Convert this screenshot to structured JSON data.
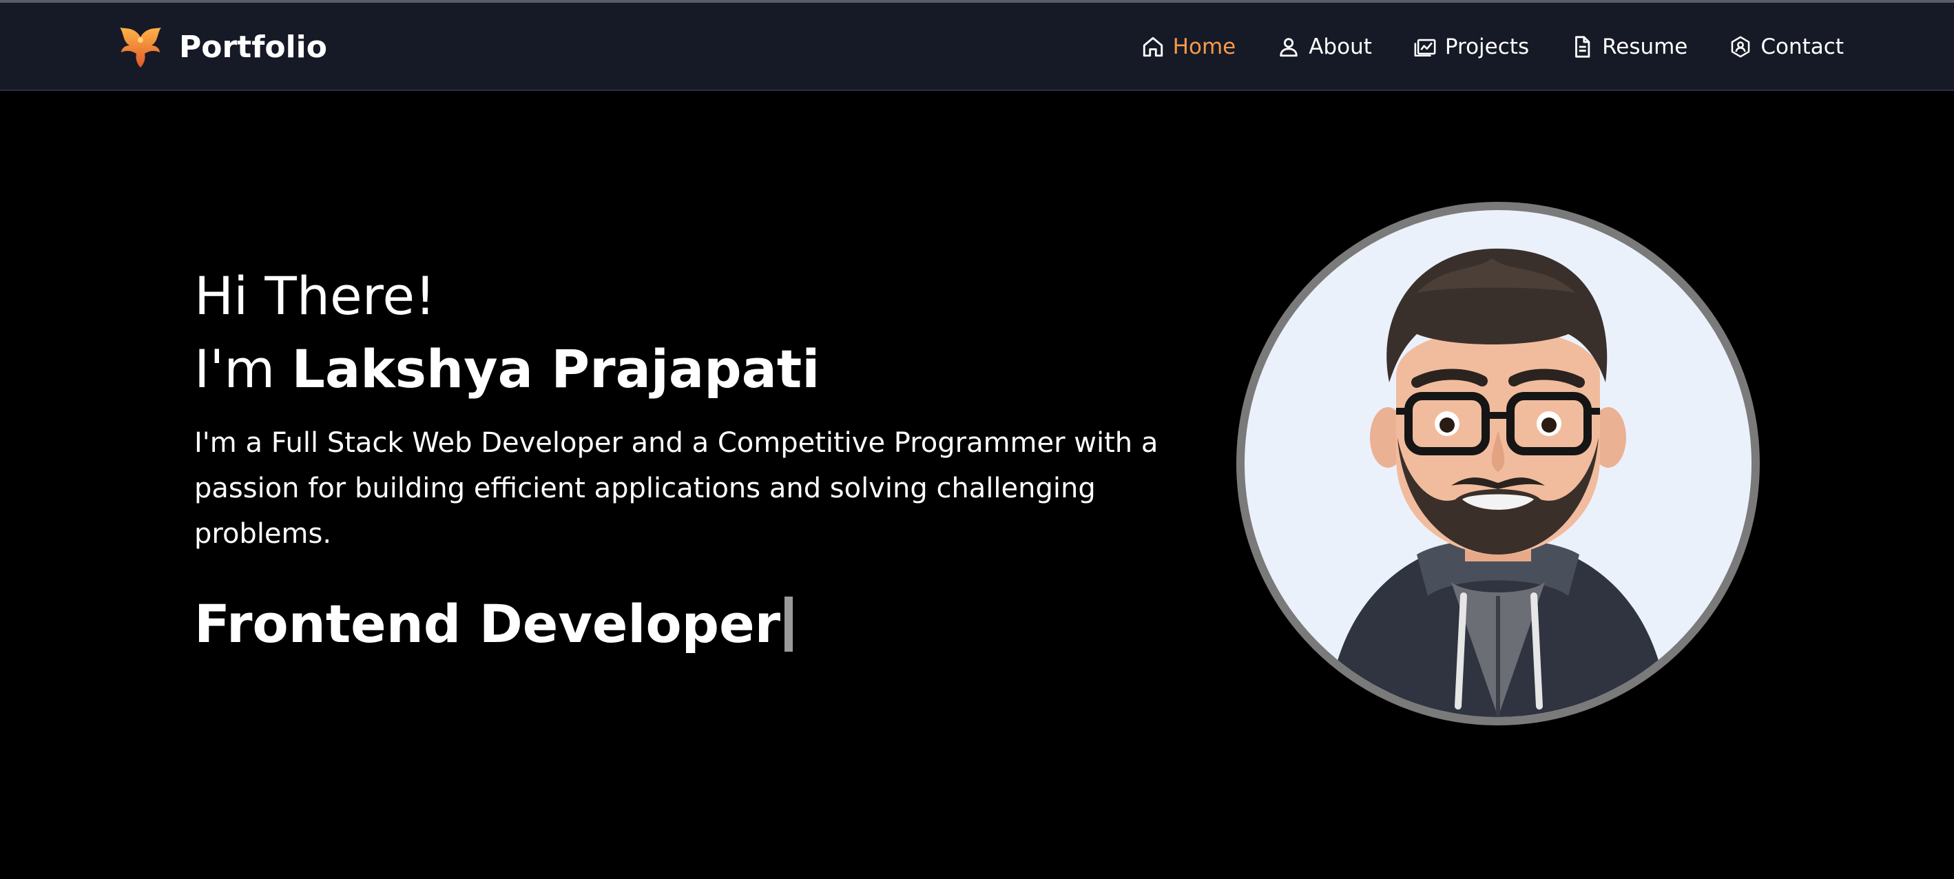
{
  "brand": {
    "title": "Portfolio",
    "logo_icon": "phoenix-logo-icon"
  },
  "nav": {
    "items": [
      {
        "label": "Home",
        "icon": "home-icon",
        "active": true
      },
      {
        "label": "About",
        "icon": "user-icon",
        "active": false
      },
      {
        "label": "Projects",
        "icon": "projects-icon",
        "active": false
      },
      {
        "label": "Resume",
        "icon": "document-icon",
        "active": false
      },
      {
        "label": "Contact",
        "icon": "contact-icon",
        "active": false
      }
    ]
  },
  "hero": {
    "greeting": "Hi There!",
    "intro_prefix": "I'm",
    "name": "Lakshya Prajapati",
    "bio": "I'm a Full Stack Web Developer and a Competitive Programmer with a passion for building efficient applications and solving challenging problems.",
    "typed_role": "Frontend Developer"
  },
  "colors": {
    "accent": "#f59a4a",
    "nav_bg": "#161a26",
    "page_bg": "#000000",
    "avatar_border": "#7a7a7a",
    "avatar_bg": "#ebf1fb"
  }
}
